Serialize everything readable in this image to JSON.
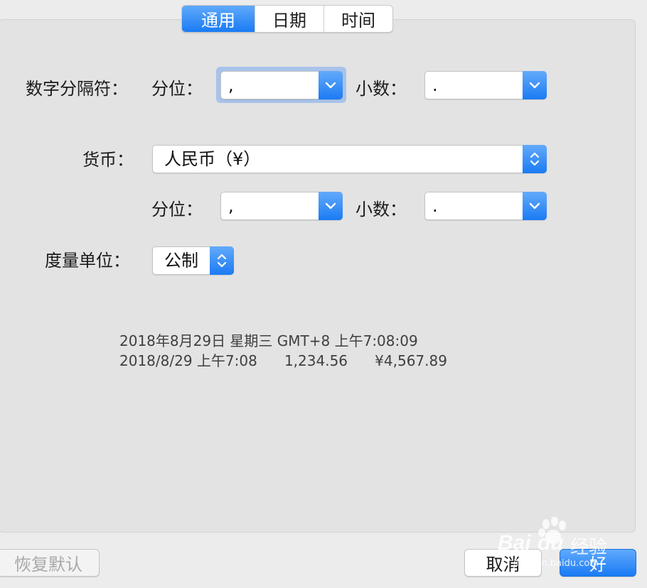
{
  "tabs": [
    {
      "label": "通用",
      "active": true
    },
    {
      "label": "日期",
      "active": false
    },
    {
      "label": "时间",
      "active": false
    }
  ],
  "number_separators": {
    "label": "数字分隔符：",
    "grouping_label": "分位：",
    "grouping_value": ",",
    "decimal_label": "小数：",
    "decimal_value": "."
  },
  "currency": {
    "label": "货币：",
    "value": "人民币（¥）",
    "grouping_label": "分位：",
    "grouping_value": ",",
    "decimal_label": "小数：",
    "decimal_value": "."
  },
  "measurement": {
    "label": "度量单位：",
    "value": "公制"
  },
  "preview": {
    "line1": "2018年8月29日 星期三 GMT+8 上午7:08:09",
    "line2": "2018/8/29 上午7:08      1,234.56      ¥4,567.89"
  },
  "buttons": {
    "restore_defaults": "恢复默认",
    "cancel": "取消",
    "ok": "好"
  },
  "watermark": {
    "brand": "Bai",
    "brand2": "du",
    "cn": "经验",
    "url": "jingyan.baidu.com"
  },
  "colors": {
    "accent": "#1a7cf4",
    "panel": "#e3e3e3",
    "window": "#ececec"
  }
}
